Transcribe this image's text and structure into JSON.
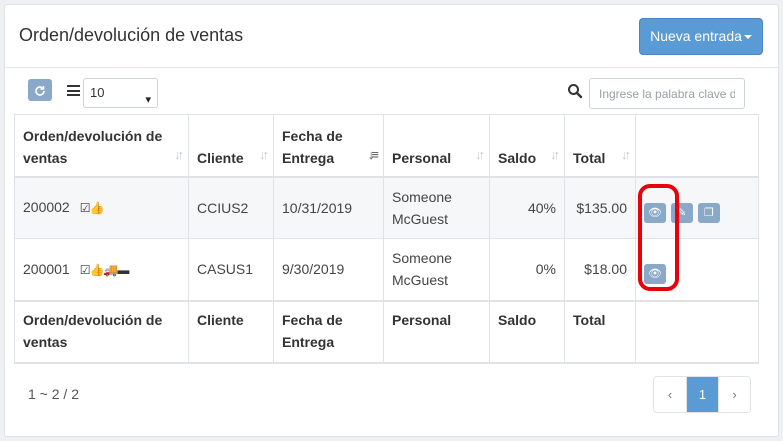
{
  "header": {
    "title": "Orden/devolución de ventas",
    "new_button_label": "Nueva entrada"
  },
  "toolbar": {
    "page_size": "10",
    "search_placeholder": "Ingrese la palabra clave d"
  },
  "table": {
    "columns": [
      "Orden/devolución de ventas",
      "Cliente",
      "Fecha de Entrega",
      "Personal",
      "Saldo",
      "Total"
    ],
    "rows": [
      {
        "order": "200002",
        "icons": "☑👍",
        "client": "CCIUS2",
        "date": "10/31/2019",
        "staff": "Someone McGuest",
        "balance": "40%",
        "total": "$135.00"
      },
      {
        "order": "200001",
        "icons": "☑👍🚚▬",
        "client": "CASUS1",
        "date": "9/30/2019",
        "staff": "Someone McGuest",
        "balance": "0%",
        "total": "$18.00"
      }
    ]
  },
  "footer": {
    "count": "1 ~ 2 / 2",
    "pager": [
      "‹",
      "1",
      "›"
    ]
  },
  "colors": {
    "accent": "#5b9bd5",
    "action_button": "#8aa8c8",
    "highlight": "#e8000b"
  }
}
